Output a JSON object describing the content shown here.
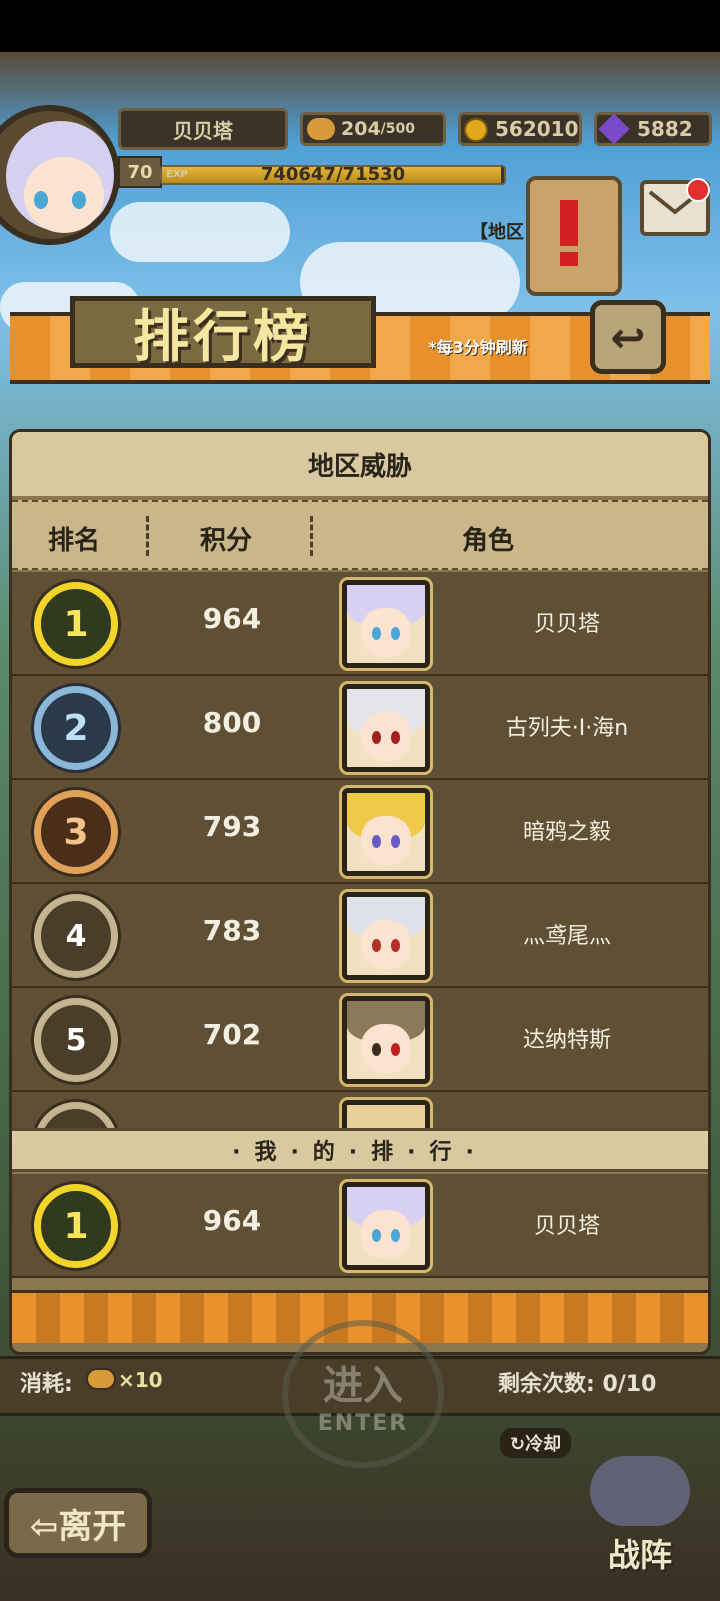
{
  "hud": {
    "player_name": "贝贝塔",
    "stamina_current": "204",
    "stamina_max": "/500",
    "gold": "562010",
    "gems": "5882",
    "level": "70",
    "exp_tag": "EXP",
    "exp_text": "740647/71530",
    "exp_fraction": 0.99,
    "region_label": "【地区"
  },
  "banner": {
    "title": "排行榜",
    "refresh_note": "*每3分钟刷新",
    "back_icon": "back-arrow-icon"
  },
  "panel": {
    "header": "地区威胁",
    "columns": [
      "排名",
      "积分",
      "角色"
    ],
    "rows": [
      {
        "rank": "1",
        "score": "964",
        "name": "贝贝塔"
      },
      {
        "rank": "2",
        "score": "800",
        "name": "古列夫·I·海n"
      },
      {
        "rank": "3",
        "score": "793",
        "name": "暗鸦之毅"
      },
      {
        "rank": "4",
        "score": "783",
        "name": "灬鸢尾灬"
      },
      {
        "rank": "5",
        "score": "702",
        "name": "达纳特斯"
      }
    ],
    "my_rank_header": "·我·的·排·行·",
    "my_rank": {
      "rank": "1",
      "score": "964",
      "name": "贝贝塔"
    }
  },
  "bottom": {
    "cost_label": "消耗:",
    "cost_value": "×10",
    "remaining_label": "剩余次数: 0/10",
    "cooldown": "↻冷却",
    "enter_cn": "进入",
    "enter_en": "ENTER",
    "leave": "⇦离开",
    "formation": "战阵"
  },
  "colors": {
    "accent_orange": "#e8902c",
    "gold_medal": "#f2d52a",
    "silver_medal": "#8ab8d8",
    "bronze_medal": "#e2a15a"
  }
}
